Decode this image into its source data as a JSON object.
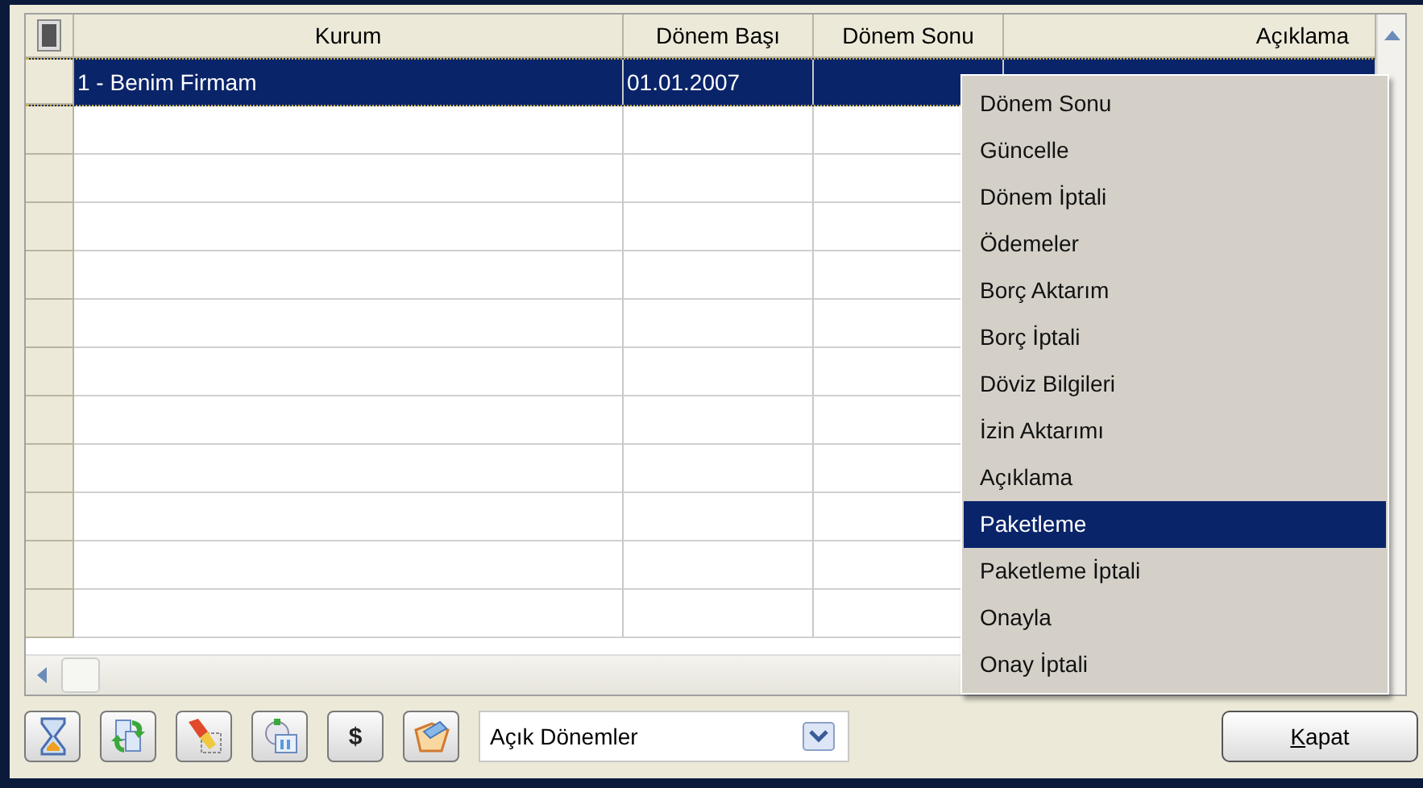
{
  "table": {
    "columns": [
      {
        "label": "Kurum"
      },
      {
        "label": "Dönem Başı"
      },
      {
        "label": "Dönem Sonu"
      },
      {
        "label": "Açıklama"
      }
    ],
    "rows": [
      {
        "cells": [
          "1 - Benim Firmam",
          "01.01.2007"
        ],
        "selected": true
      },
      {
        "cells": [],
        "selected": false
      },
      {
        "cells": [],
        "selected": false
      },
      {
        "cells": [],
        "selected": false
      },
      {
        "cells": [],
        "selected": false
      },
      {
        "cells": [],
        "selected": false
      },
      {
        "cells": [],
        "selected": false
      },
      {
        "cells": [],
        "selected": false
      },
      {
        "cells": [],
        "selected": false
      },
      {
        "cells": [],
        "selected": false
      },
      {
        "cells": [],
        "selected": false
      },
      {
        "cells": [],
        "selected": false
      }
    ]
  },
  "context_menu": {
    "items": [
      {
        "label": "Dönem Sonu",
        "selected": false
      },
      {
        "label": "Güncelle",
        "selected": false
      },
      {
        "label": "Dönem İptali",
        "selected": false
      },
      {
        "label": "Ödemeler",
        "selected": false
      },
      {
        "label": "Borç Aktarım",
        "selected": false
      },
      {
        "label": "Borç İptali",
        "selected": false
      },
      {
        "label": "Döviz Bilgileri",
        "selected": false
      },
      {
        "label": "İzin Aktarımı",
        "selected": false
      },
      {
        "label": "Açıklama",
        "selected": false
      },
      {
        "label": "Paketleme",
        "selected": true
      },
      {
        "label": "Paketleme İptali",
        "selected": false
      },
      {
        "label": "Onayla",
        "selected": false
      },
      {
        "label": "Onay İptali",
        "selected": false
      }
    ]
  },
  "toolbar": {
    "buttons": [
      {
        "kind": "hourglass"
      },
      {
        "kind": "swap"
      },
      {
        "kind": "brush"
      },
      {
        "kind": "device"
      },
      {
        "kind": "text",
        "label": "$"
      },
      {
        "kind": "box"
      }
    ],
    "filter": {
      "value": "Açık Dönemler"
    },
    "close_button": {
      "label": "Kapat"
    }
  }
}
